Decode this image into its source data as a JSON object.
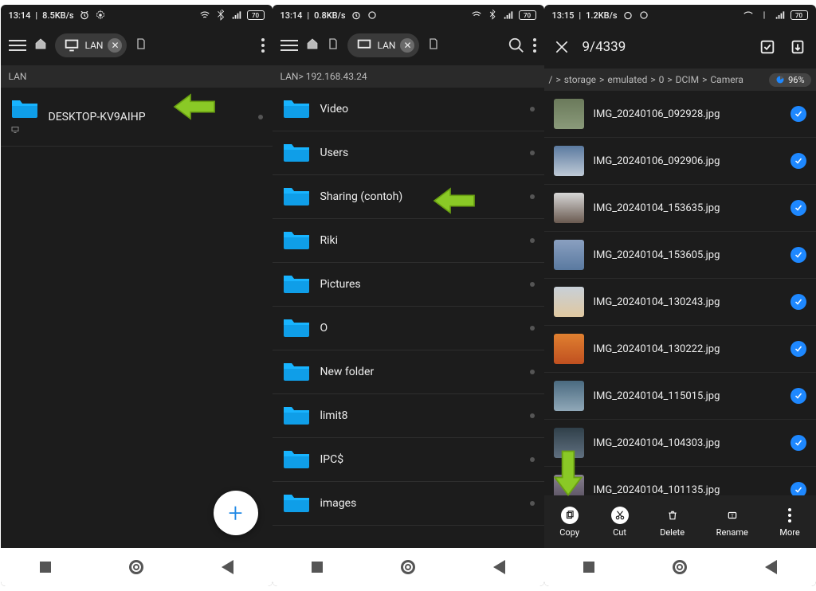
{
  "screens": [
    {
      "status": {
        "time": "13:14",
        "net": "8.5KB/s",
        "battery": "70"
      },
      "toolbar": {
        "tab": "LAN"
      },
      "crumb": "LAN",
      "rows": [
        {
          "label": "DESKTOP-KV9AIHP",
          "kind": "pc"
        }
      ]
    },
    {
      "status": {
        "time": "13:14",
        "net": "0.8KB/s",
        "battery": "70"
      },
      "toolbar": {
        "tab": "LAN"
      },
      "crumb": "LAN> 192.168.43.24",
      "rows": [
        {
          "label": "Video"
        },
        {
          "label": "Users"
        },
        {
          "label": "Sharing (contoh)"
        },
        {
          "label": "Riki"
        },
        {
          "label": "Pictures"
        },
        {
          "label": "O"
        },
        {
          "label": "New folder"
        },
        {
          "label": "limit8"
        },
        {
          "label": "IPC$"
        },
        {
          "label": "images"
        }
      ]
    },
    {
      "status": {
        "time": "13:15",
        "net": "1.2KB/s",
        "battery": "70"
      },
      "selection_title": "9/4339",
      "crumb_parts": [
        "/",
        ">",
        "storage",
        ">",
        "emulated",
        ">",
        "0",
        ">",
        "DCIM",
        ">",
        "Camera"
      ],
      "storage_pct": "96%",
      "files": [
        {
          "name": "IMG_20240106_092928.jpg"
        },
        {
          "name": "IMG_20240106_092906.jpg"
        },
        {
          "name": "IMG_20240104_153635.jpg"
        },
        {
          "name": "IMG_20240104_153605.jpg"
        },
        {
          "name": "IMG_20240104_130243.jpg"
        },
        {
          "name": "IMG_20240104_130222.jpg"
        },
        {
          "name": "IMG_20240104_115015.jpg"
        },
        {
          "name": "IMG_20240104_104303.jpg"
        },
        {
          "name": "IMG_20240104_101135.jpg"
        }
      ],
      "bottombar": {
        "copy": "Copy",
        "cut": "Cut",
        "delete": "Delete",
        "rename": "Rename",
        "more": "More"
      }
    }
  ],
  "thumb_colors": [
    "linear-gradient(#6b7a5b,#8a9a7a)",
    "linear-gradient(#5b7aa0,#bfcad6)",
    "linear-gradient(#d7d7d7,#6a5a50)",
    "linear-gradient(#8aa0c0,#5a7aa0)",
    "linear-gradient(#c8d0d8,#e0c8a0)",
    "linear-gradient(#e08030,#c05020)",
    "linear-gradient(#4a6a80,#90a8b8)",
    "linear-gradient(#30404a,#607080)",
    "linear-gradient(#888090,#504858)"
  ]
}
